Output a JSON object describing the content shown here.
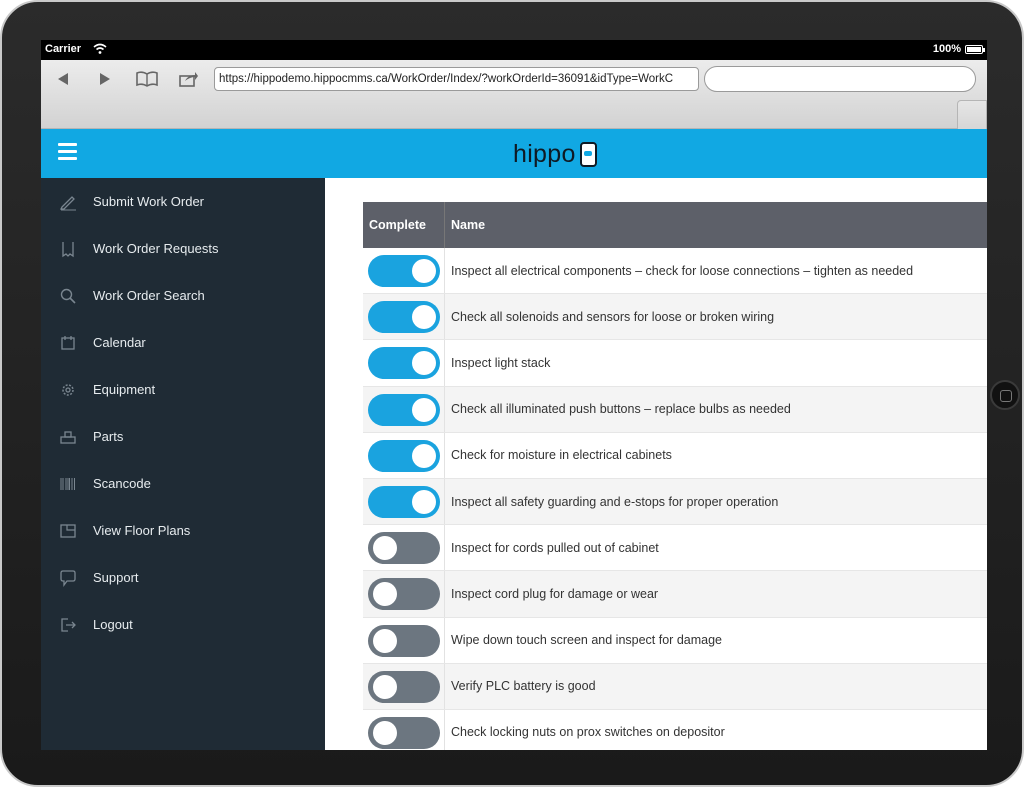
{
  "status_bar": {
    "carrier": "Carrier",
    "battery": "100%"
  },
  "browser": {
    "url": "https://hippodemo.hippocmms.ca/WorkOrder/Index/?workOrderId=36091&idType=WorkC",
    "search_value": ""
  },
  "header": {
    "brand": "hippo",
    "accent_color": "#11a8e3"
  },
  "sidebar": {
    "items": [
      {
        "label": "Submit Work Order",
        "icon": "pencil-icon"
      },
      {
        "label": "Work Order Requests",
        "icon": "clipboard-icon"
      },
      {
        "label": "Work Order Search",
        "icon": "search-icon"
      },
      {
        "label": "Calendar",
        "icon": "calendar-icon"
      },
      {
        "label": "Equipment",
        "icon": "gear-icon"
      },
      {
        "label": "Parts",
        "icon": "parts-icon"
      },
      {
        "label": "Scancode",
        "icon": "barcode-icon"
      },
      {
        "label": "View Floor Plans",
        "icon": "floorplan-icon"
      },
      {
        "label": "Support",
        "icon": "chat-bubble-icon"
      },
      {
        "label": "Logout",
        "icon": "logout-icon"
      }
    ]
  },
  "table": {
    "headers": {
      "complete": "Complete",
      "name": "Name"
    },
    "rows": [
      {
        "complete": true,
        "name": "Inspect all electrical components – check for loose connections – tighten as needed"
      },
      {
        "complete": true,
        "name": "Check all solenoids and sensors for loose or broken wiring"
      },
      {
        "complete": true,
        "name": "Inspect light stack"
      },
      {
        "complete": true,
        "name": "Check all illuminated push buttons – replace bulbs as needed"
      },
      {
        "complete": true,
        "name": "Check for moisture in electrical cabinets"
      },
      {
        "complete": true,
        "name": "Inspect all safety guarding and e-stops for proper operation"
      },
      {
        "complete": false,
        "name": "Inspect for cords pulled out of cabinet"
      },
      {
        "complete": false,
        "name": "Inspect cord plug for damage or wear"
      },
      {
        "complete": false,
        "name": "Wipe down touch screen and inspect for damage"
      },
      {
        "complete": false,
        "name": "Verify PLC battery is good"
      },
      {
        "complete": false,
        "name": "Check locking nuts on prox switches on depositor"
      }
    ]
  }
}
